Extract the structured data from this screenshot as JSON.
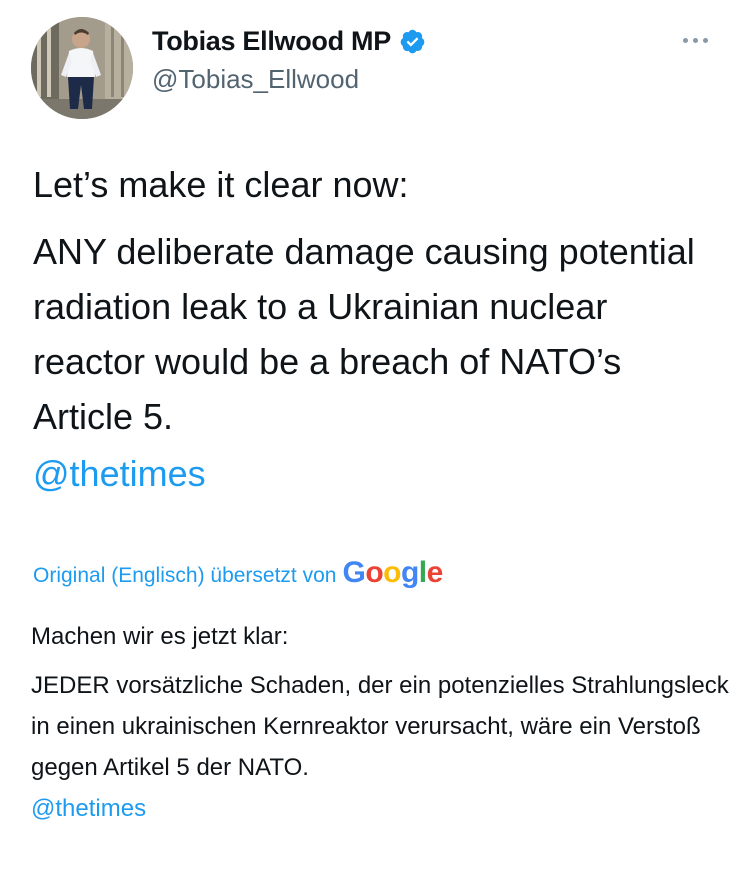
{
  "author": {
    "name": "Tobias Ellwood MP",
    "handle": "@Tobias_Ellwood",
    "verified": true,
    "avatar_icon": "profile-photo"
  },
  "menu_icon": "more-dots-icon",
  "tweet": {
    "line1": "Let’s make it clear now:",
    "line2": "ANY deliberate damage causing potential radiation leak to a Ukrainian nuclear reactor would be a breach of NATO’s Article 5.",
    "mention": "@thetimes"
  },
  "translation": {
    "label": "Original (Englisch) übersetzt von",
    "provider": "Google",
    "line1": "Machen wir es jetzt klar:",
    "line2": "JEDER vorsätzliche Schaden, der ein potenzielles Strahlungsleck in einen ukrainischen Kernreaktor verursacht, wäre ein Verstoß gegen Artikel 5 der NATO.",
    "mention": "@thetimes"
  },
  "colors": {
    "link": "#1d9bf0",
    "secondary_text": "#536471",
    "verified_badge": "#1d9bf0"
  }
}
